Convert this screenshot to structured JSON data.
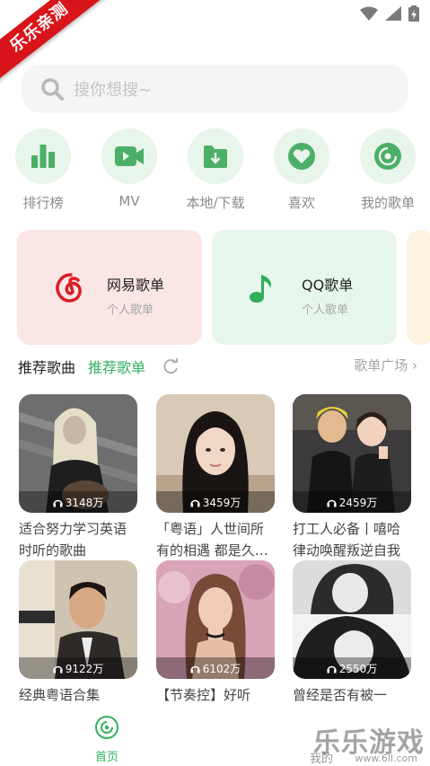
{
  "watermark": {
    "corner_text": "乐乐亲测",
    "brand_text": "乐乐游戏",
    "brand_url": "www.6ll.com"
  },
  "search": {
    "placeholder": "搜你想搜~"
  },
  "quick_nav": [
    {
      "label": "排行榜",
      "icon": "chart-bars-icon"
    },
    {
      "label": "MV",
      "icon": "video-camera-icon"
    },
    {
      "label": "本地/下载",
      "icon": "folder-download-icon"
    },
    {
      "label": "喜欢",
      "icon": "heart-icon"
    },
    {
      "label": "我的歌单",
      "icon": "disc-icon"
    }
  ],
  "playlist_cards": [
    {
      "title": "网易歌单",
      "subtitle": "个人歌单",
      "icon": "netease-icon",
      "bg": "#fbe6e6",
      "accent": "#d81f26"
    },
    {
      "title": "QQ歌单",
      "subtitle": "个人歌单",
      "icon": "music-note-icon",
      "bg": "#e7f6ec",
      "accent": "#2fae5b"
    }
  ],
  "section": {
    "tab_songs": "推荐歌曲",
    "tab_playlists": "推荐歌单",
    "more": "歌单广场"
  },
  "songs": [
    {
      "plays": "3148万",
      "title": "适合努力学习英语时听的歌曲"
    },
    {
      "plays": "3459万",
      "title": "「粤语」人世间所有的相遇 都是久…"
    },
    {
      "plays": "2459万",
      "title": "打工人必备丨嘻哈律动唤醒叛逆自我"
    },
    {
      "plays": "9122万",
      "title": "经典粤语合集【无…"
    },
    {
      "plays": "6102万",
      "title": "【节奏控】好听又…"
    },
    {
      "plays": "2550万",
      "title": "曾经是否有被一句…"
    }
  ],
  "tabbar": {
    "home": "首页",
    "mine": "我的"
  },
  "colors": {
    "accent": "#32b260",
    "quicknav_bg": "#e8f5ea"
  }
}
